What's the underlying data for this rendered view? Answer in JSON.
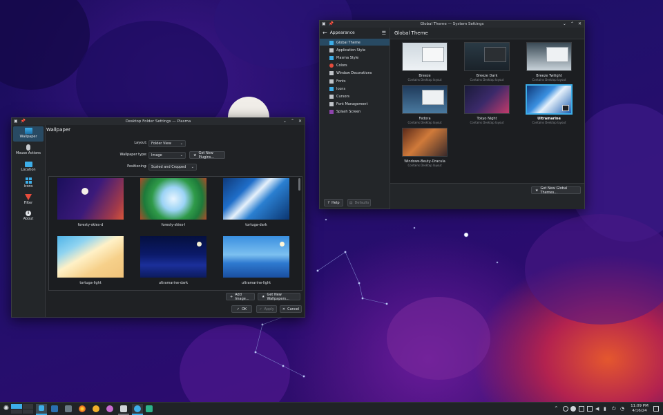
{
  "desktop_window": {
    "title": "Desktop Folder Settings — Plasma",
    "sidebar": [
      {
        "label": "Wallpaper",
        "icon": "image-icon"
      },
      {
        "label": "Mouse Actions",
        "icon": "mouse-icon"
      },
      {
        "label": "Location",
        "icon": "folder-icon"
      },
      {
        "label": "Icons",
        "icon": "grid-icon"
      },
      {
        "label": "Filter",
        "icon": "funnel-icon"
      },
      {
        "label": "About",
        "icon": "info-icon"
      }
    ],
    "heading": "Wallpaper",
    "layout_label": "Layout:",
    "layout_value": "Folder View",
    "type_label": "Wallpaper type:",
    "type_value": "Image",
    "get_plugins": "Get New Plugins...",
    "positioning_label": "Positioning:",
    "positioning_value": "Scaled and Cropped",
    "wallpapers": [
      "foresty-skies-d",
      "foresty-skies-l",
      "tortuga-dark",
      "tortuga-light",
      "ultramarine-dark",
      "ultramarine-light"
    ],
    "add_image": "Add Image...",
    "get_wallpapers": "Get New Wallpapers...",
    "ok": "OK",
    "apply": "Apply",
    "cancel": "Cancel"
  },
  "settings_window": {
    "title": "Global Theme — System Settings",
    "back_label": "Appearance",
    "page_title": "Global Theme",
    "nav": [
      "Global Theme",
      "Application Style",
      "Plasma Style",
      "Colors",
      "Window Decorations",
      "Fonts",
      "Icons",
      "Cursors",
      "Font Management",
      "Splash Screen"
    ],
    "nav_icon_colors": [
      "#3daee9",
      "#c0c4c9",
      "#3daee9",
      "#e74c3c",
      "#c0c4c9",
      "#c0c4c9",
      "#3daee9",
      "#c0c4c9",
      "#c0c4c9",
      "#8e44ad"
    ],
    "themes": [
      {
        "name": "Breeze",
        "sub": "Contains Desktop layout"
      },
      {
        "name": "Breeze Dark",
        "sub": "Contains Desktop layout"
      },
      {
        "name": "Breeze Twilight",
        "sub": "Contains Desktop layout"
      },
      {
        "name": "Fedora",
        "sub": "Contains Desktop layout"
      },
      {
        "name": "Tokyo Night",
        "sub": "Contains Desktop layout"
      },
      {
        "name": "Ultramarine",
        "sub": "Contains Desktop layout"
      },
      {
        "name": "Windows-Beuty-Dracula",
        "sub": "Contains Desktop layout"
      }
    ],
    "get_themes": "Get New Global Themes...",
    "help": "Help",
    "defaults": "Defaults"
  },
  "taskbar": {
    "time": "11:09 PM",
    "date": "4/16/24"
  },
  "colors": {
    "accent": "#3daee9",
    "selected_bg": "#284a63"
  }
}
